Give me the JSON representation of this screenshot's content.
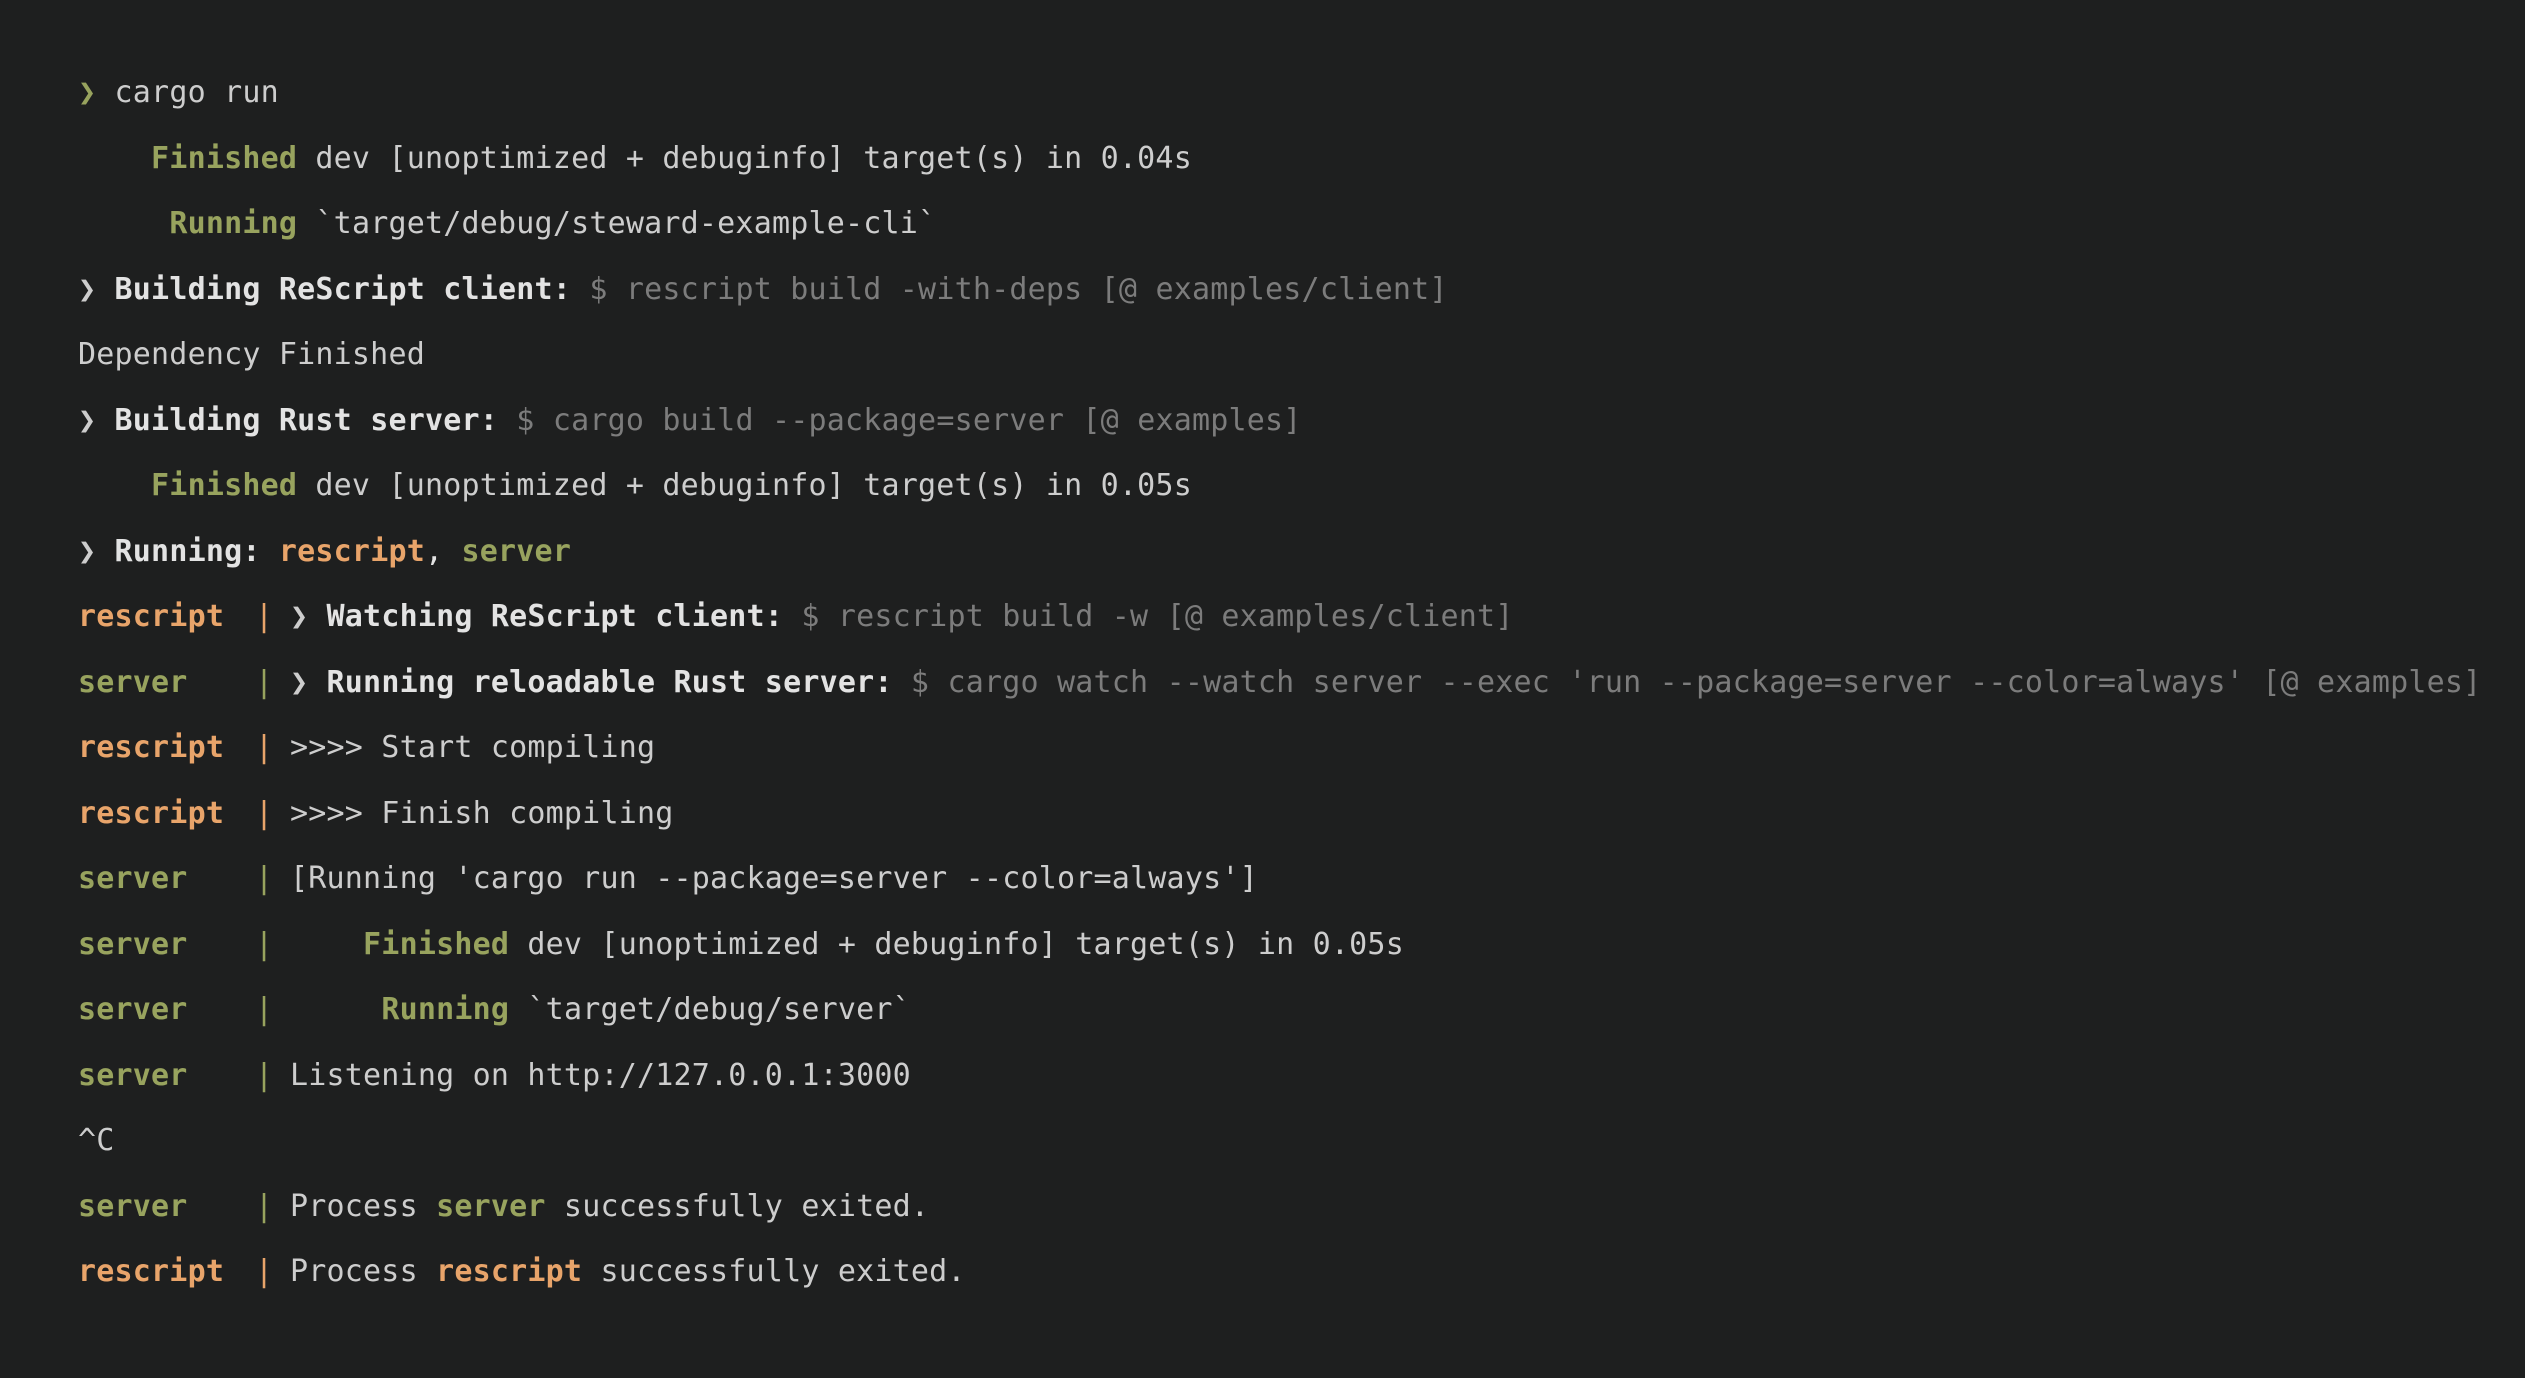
{
  "terminal": {
    "background_color": "#1e1f1f",
    "text_color": "#cdcdcd",
    "dim_color": "#7c7c7c",
    "rescript_color": "#e8a46a",
    "server_color": "#98a35e",
    "prompt_symbol": "❯",
    "pipe_symbol": "|"
  },
  "lines": {
    "l1": {
      "prompt": "❯",
      "command": "cargo run"
    },
    "l2": {
      "status": "Finished",
      "rest": "dev [unoptimized + debuginfo] target(s) in 0.04s"
    },
    "l3": {
      "status": "Running",
      "rest": "`target/debug/steward-example-cli`"
    },
    "l4": {
      "prompt": "❯",
      "label": "Building ReScript client:",
      "dollar": "$",
      "command": "rescript build -with-deps [@ examples/client]"
    },
    "l5": {
      "text": "Dependency Finished"
    },
    "l6": {
      "prompt": "❯",
      "label": "Building Rust server:",
      "dollar": "$",
      "command": "cargo build --package=server [@ examples]"
    },
    "l7": {
      "status": "Finished",
      "rest": "dev [unoptimized + debuginfo] target(s) in 0.05s"
    },
    "l8": {
      "prompt": "❯",
      "label": "Running:",
      "proc_a": "rescript",
      "sep": ",",
      "proc_b": "server"
    },
    "l9": {
      "prefix": "rescript",
      "pipe": "|",
      "prompt": "❯",
      "label": "Watching ReScript client:",
      "dollar": "$",
      "command": "rescript build -w [@ examples/client]"
    },
    "l10": {
      "prefix": "server",
      "pipe": "|",
      "prompt": "❯",
      "label": "Running reloadable Rust server:",
      "dollar": "$",
      "command": "cargo watch --watch server --exec 'run --package=server --color=always' [@ examples]"
    },
    "l11": {
      "prefix": "rescript",
      "pipe": "|",
      "text": ">>>> Start compiling"
    },
    "l12": {
      "prefix": "rescript",
      "pipe": "|",
      "text": ">>>> Finish compiling"
    },
    "l13": {
      "prefix": "server",
      "pipe": "|",
      "text": "[Running 'cargo run --package=server --color=always']"
    },
    "l14": {
      "prefix": "server",
      "pipe": "|",
      "indent": "    ",
      "status": "Finished",
      "rest": "dev [unoptimized + debuginfo] target(s) in 0.05s"
    },
    "l15": {
      "prefix": "server",
      "pipe": "|",
      "indent": "     ",
      "status": "Running",
      "rest": "`target/debug/server`"
    },
    "l16": {
      "prefix": "server",
      "pipe": "|",
      "text": "Listening on http://127.0.0.1:3000"
    },
    "l17": {
      "text": "^C"
    },
    "l18": {
      "prefix": "server",
      "pipe": "|",
      "pre": "Process ",
      "proc": "server",
      "post": " successfully exited."
    },
    "l19": {
      "prefix": "rescript",
      "pipe": "|",
      "pre": "Process ",
      "proc": "rescript",
      "post": " successfully exited."
    }
  }
}
